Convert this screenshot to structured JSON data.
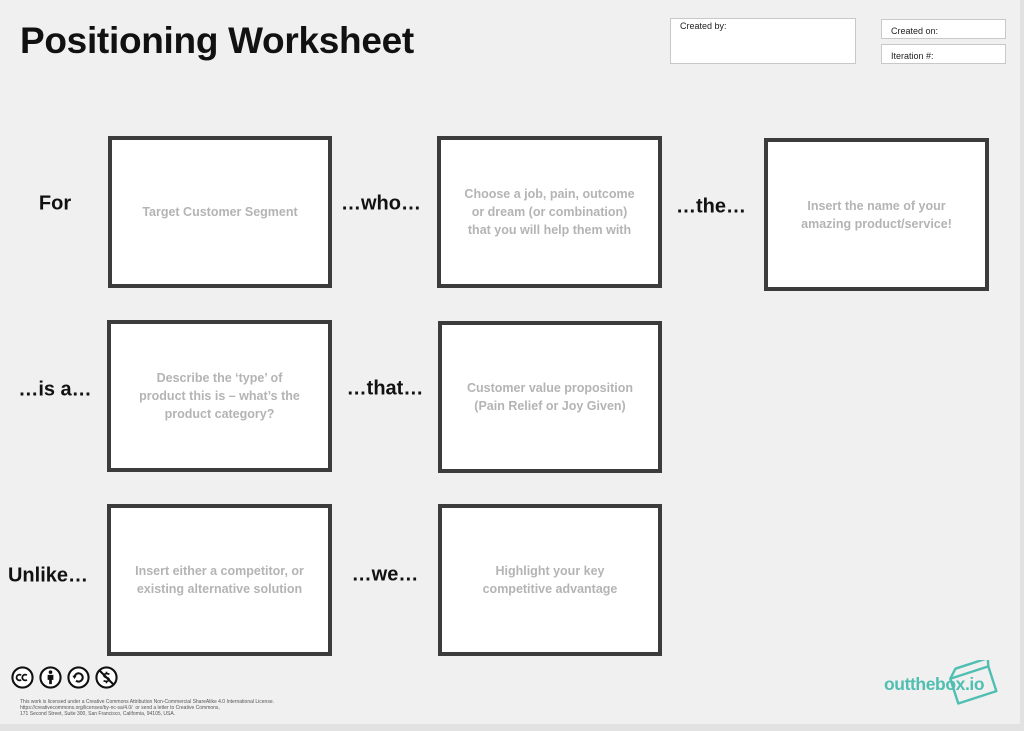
{
  "header": {
    "title": "Positioning Worksheet",
    "created_by_label": "Created by:",
    "created_on_label": "Created on:",
    "iteration_label": "Iteration #:"
  },
  "rows": [
    {
      "lead": "For",
      "cards": [
        "Target Customer Segment",
        "Choose a job, pain, outcome or dream (or combination) that you will help them with",
        "Insert the name of your amazing product/service!"
      ],
      "connectors": [
        "…who…",
        "…the…"
      ]
    },
    {
      "lead": "…is a…",
      "cards": [
        "Describe the ‘type’ of product this is – what’s the product category?",
        "Customer value proposition (Pain Relief or Joy Given)"
      ],
      "connectors": [
        "…that…"
      ]
    },
    {
      "lead": "Unlike…",
      "cards": [
        "Insert either a competitor, or existing alternative solution",
        "Highlight your key competitive advantage"
      ],
      "connectors": [
        "…we…"
      ]
    }
  ],
  "footer": {
    "license_line1": "This work is licensed under a Creative Commons Attribution Non-Commercial ShareAlike 4.0 International License.",
    "license_line2": "https://creativecommons.org/licenses/by-nc-sa/4.0/  or send a letter to Creative Commons,",
    "license_line3": "171 Second Street, Suite 300, San Francisco, California, 94105, USA.",
    "cc_icons": [
      "cc-icon",
      "attribution-icon",
      "share-alike-icon",
      "non-commercial-icon"
    ],
    "logo_text": "outthebox.io"
  },
  "colors": {
    "card_border": "#3c3c3c",
    "placeholder_text": "#b4b4b4",
    "logo_teal": "#4fbfb1"
  }
}
